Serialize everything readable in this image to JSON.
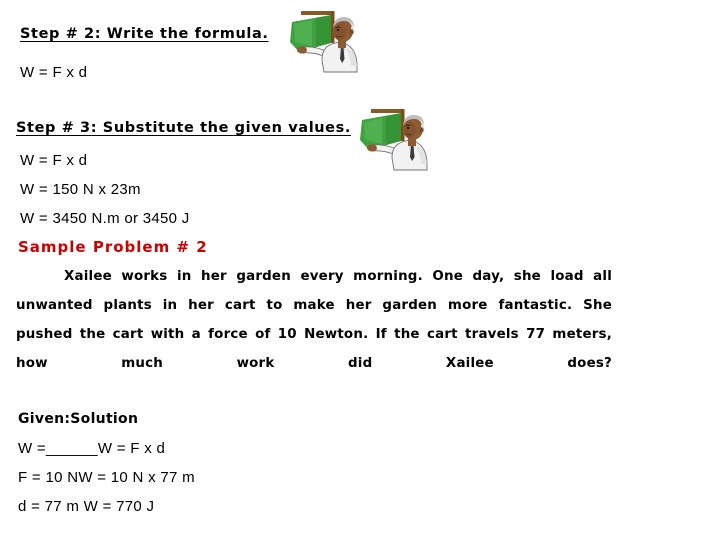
{
  "slide": {
    "background_color": "#ffffff",
    "accent_red": "#CC0000",
    "text_color": "#000000",
    "board_green": "#3FA13F",
    "board_frame_brown": "#8A5A22",
    "coat_white": "#F2F2F2",
    "skin_tone": "#8C5A33",
    "hair_grey": "#BDBDBD"
  },
  "steps": {
    "step2_heading": "Step # 2: Write the formula.",
    "step2_formula": "W = F x d",
    "step3_heading": " Step # 3: Substitute the given values. ",
    "step3_lines": [
      "W = F x d",
      "W = 150 N x 23m",
      "W = 3450 N.m or 3450 J"
    ]
  },
  "sample_problem": {
    "title": "Sample Problem # 2",
    "body": "Xailee works in her garden every morning. One day, she load all unwanted plants in her cart to make her garden more fantastic. She pushed the cart with a force of 10 Newton. If the cart travels 77 meters, how much work did Xailee does?"
  },
  "solution": {
    "heading": "Given:Solution",
    "lines": [
      "W =______W = F x d",
      "F = 10 NW = 10 N x 77 m",
      "d = 77 m W = 770 J"
    ]
  },
  "clipart": {
    "name": "teacher-pointing-at-green-board",
    "count": 2
  }
}
